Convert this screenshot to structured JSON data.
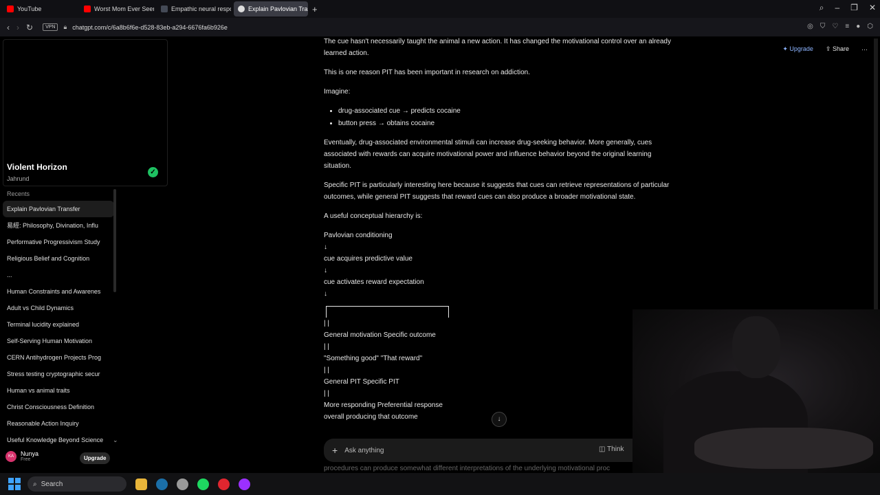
{
  "browser": {
    "tabs": [
      {
        "title": "YouTube",
        "favicon_color": "#ff0000",
        "active": false
      },
      {
        "title": "Worst Mom Ever Seen on",
        "favicon_color": "#ff0000",
        "active": false
      },
      {
        "title": "Empathic neural response",
        "favicon_color": "#444a56",
        "active": false
      },
      {
        "title": "Explain Pavlovian Transfer",
        "favicon_color": "#dddddd",
        "active": true
      }
    ],
    "new_tab_label": "+",
    "vpn_label": "VPN",
    "url": "chatgpt.com/c/6a8b6f6e-d528-83eb-a294-6676fa6b926e"
  },
  "sidebar": {
    "profile_name": "Violent Horizon",
    "profile_sub": "Jahrund",
    "recents_header": "Recents",
    "recents": [
      "Explain Pavlovian Transfer",
      "易經: Philosophy, Divination, Influ",
      "Performative Progressivism Study",
      "Religious Belief and Cognition",
      "...",
      "Human Constraints and Awarenes",
      "Adult vs Child Dynamics",
      "Terminal lucidity explained",
      "Self-Serving Human Motivation",
      "CERN Antihydrogen Projects Prog",
      "Stress testing cryptographic secur",
      "Human vs animal traits",
      "Christ Consciousness Definition",
      "Reasonable Action Inquiry",
      "Useful Knowledge Beyond Science"
    ],
    "user": {
      "initials": "KA",
      "name": "Nunya",
      "plan": "Free",
      "upgrade_label": "Upgrade"
    }
  },
  "header_actions": {
    "upgrade": "Upgrade",
    "share": "Share",
    "more": "···"
  },
  "conversation": {
    "p1": "The cue hasn't necessarily taught the animal a new action. It has changed the motivational control over an already learned action.",
    "p2": "This is one reason PIT has been important in research on addiction.",
    "p3": "Imagine:",
    "bullets": [
      "drug-associated cue → predicts cocaine",
      "button press → obtains cocaine"
    ],
    "p4": "Eventually, drug-associated environmental stimuli can increase drug-seeking behavior. More generally, cues associated with rewards can acquire motivational power and influence behavior beyond the original learning situation.",
    "p5": "Specific PIT is particularly interesting here because it suggests that cues can retrieve representations of particular outcomes, while general PIT suggests that reward cues can also produce a broader motivational state.",
    "p6": "A useful conceptual hierarchy is:",
    "hierarchy_top": [
      "Pavlovian conditioning",
      "↓",
      "cue acquires predictive value",
      "↓",
      "cue activates reward expectation",
      "↓"
    ],
    "hierarchy_bottom": [
      "| |",
      "General motivation Specific outcome",
      "| |",
      "\"Something good\" \"That reward\"",
      "| |",
      "General PIT Specific PIT",
      "| |",
      "More responding Preferential response",
      "overall producing that outcome"
    ],
    "peek_text": "procedures can produce somewhat different interpretations of the underlying motivational proc"
  },
  "composer": {
    "placeholder": "Ask anything",
    "think_label": "Think",
    "plus": "+"
  },
  "taskbar": {
    "search_label": "Search",
    "apps": [
      {
        "name": "file-explorer",
        "color": "#e8b53a"
      },
      {
        "name": "steam",
        "color": "#1b6fa8"
      },
      {
        "name": "chrome-like",
        "color": "#9a9a9a"
      },
      {
        "name": "spotify",
        "color": "#1ed760"
      },
      {
        "name": "opera",
        "color": "#e0262f"
      },
      {
        "name": "opera-gx",
        "color": "#9b30ff"
      }
    ]
  }
}
